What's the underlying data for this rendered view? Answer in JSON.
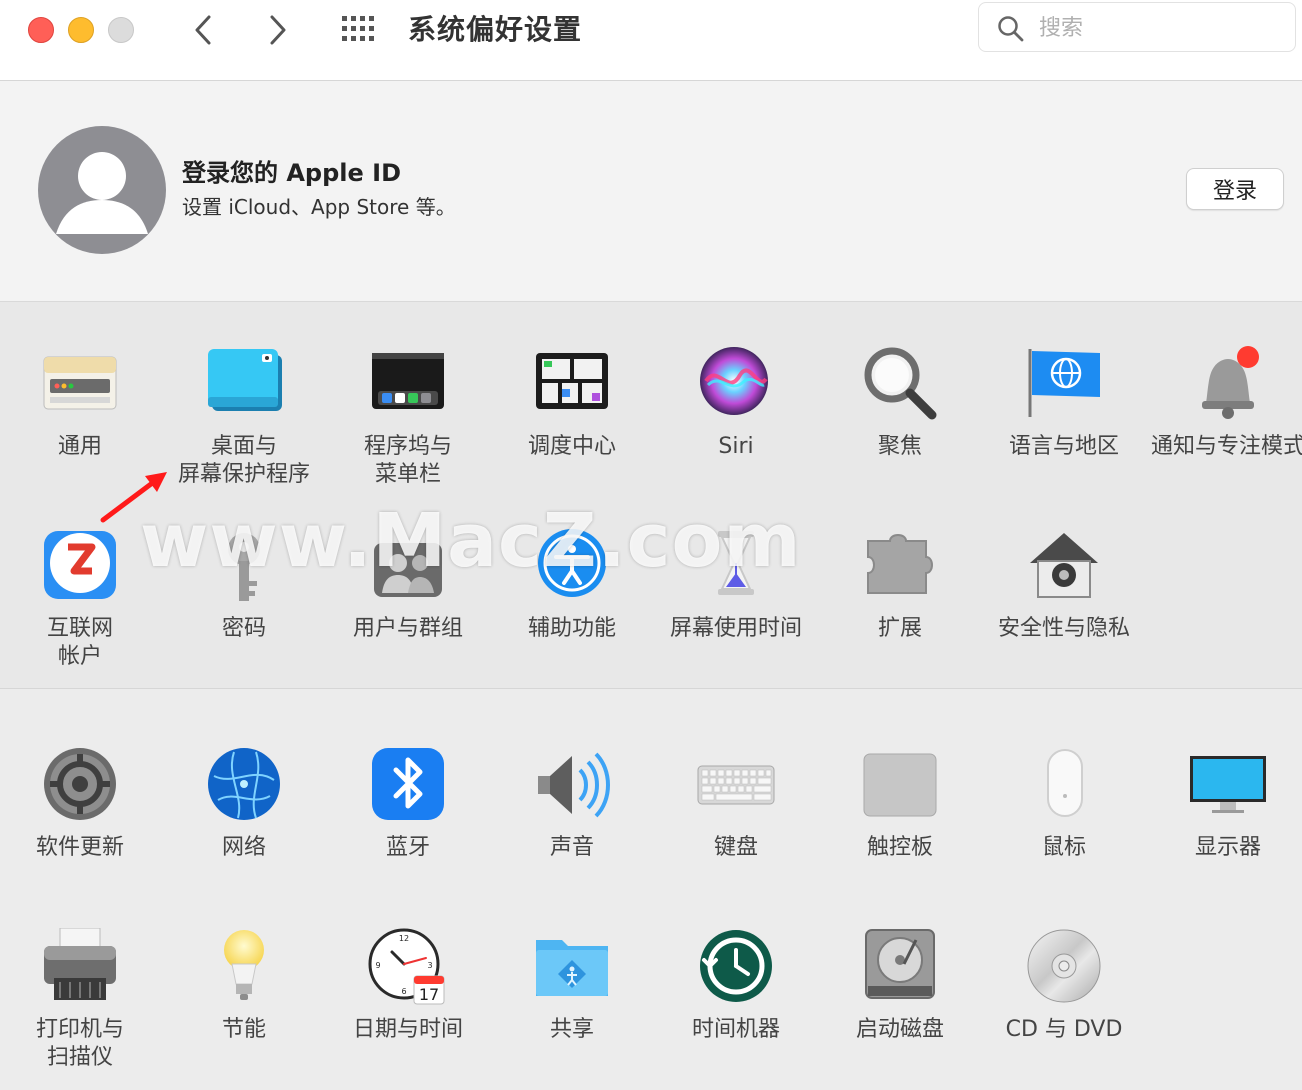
{
  "window": {
    "title": "系统偏好设置",
    "search_placeholder": "搜索"
  },
  "account": {
    "title": "登录您的 Apple ID",
    "subtitle": "设置 iCloud、App Store 等。",
    "login_button": "登录"
  },
  "row1": [
    {
      "label": "通用",
      "icon": "general-icon"
    },
    {
      "label": "桌面与\n屏幕保护程序",
      "icon": "desktop-screensaver-icon"
    },
    {
      "label": "程序坞与\n菜单栏",
      "icon": "dock-menubar-icon"
    },
    {
      "label": "调度中心",
      "icon": "mission-control-icon"
    },
    {
      "label": "Siri",
      "icon": "siri-icon"
    },
    {
      "label": "聚焦",
      "icon": "spotlight-icon"
    },
    {
      "label": "语言与地区",
      "icon": "language-region-icon"
    },
    {
      "label": "通知与专注模式",
      "icon": "notifications-icon"
    }
  ],
  "row2": [
    {
      "label": "互联网\n帐户",
      "icon": "internet-accounts-icon"
    },
    {
      "label": "密码",
      "icon": "passwords-icon"
    },
    {
      "label": "用户与群组",
      "icon": "users-groups-icon"
    },
    {
      "label": "辅助功能",
      "icon": "accessibility-icon"
    },
    {
      "label": "屏幕使用时间",
      "icon": "screen-time-icon"
    },
    {
      "label": "扩展",
      "icon": "extensions-icon"
    },
    {
      "label": "安全性与隐私",
      "icon": "security-privacy-icon"
    }
  ],
  "row3": [
    {
      "label": "软件更新",
      "icon": "software-update-icon"
    },
    {
      "label": "网络",
      "icon": "network-icon"
    },
    {
      "label": "蓝牙",
      "icon": "bluetooth-icon"
    },
    {
      "label": "声音",
      "icon": "sound-icon"
    },
    {
      "label": "键盘",
      "icon": "keyboard-icon"
    },
    {
      "label": "触控板",
      "icon": "trackpad-icon"
    },
    {
      "label": "鼠标",
      "icon": "mouse-icon"
    },
    {
      "label": "显示器",
      "icon": "displays-icon"
    }
  ],
  "row4": [
    {
      "label": "打印机与\n扫描仪",
      "icon": "printers-scanners-icon"
    },
    {
      "label": "节能",
      "icon": "energy-saver-icon"
    },
    {
      "label": "日期与时间",
      "icon": "date-time-icon"
    },
    {
      "label": "共享",
      "icon": "sharing-icon"
    },
    {
      "label": "时间机器",
      "icon": "time-machine-icon"
    },
    {
      "label": "启动磁盘",
      "icon": "startup-disk-icon"
    },
    {
      "label": "CD 与 DVD",
      "icon": "cd-dvd-icon"
    }
  ],
  "calendar_day": "17",
  "watermark": "www.MacZ.com"
}
